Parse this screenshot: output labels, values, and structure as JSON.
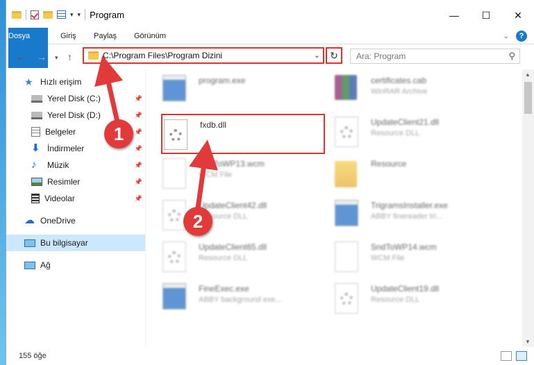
{
  "window": {
    "title": "Program",
    "controls": [
      "minimize",
      "maximize",
      "close"
    ]
  },
  "ribbon": {
    "tabs": [
      "Dosya",
      "Giriş",
      "Paylaş",
      "Görünüm"
    ]
  },
  "address": {
    "path": "C:\\Program Files\\Program Dizini",
    "search_placeholder": "Ara: Program"
  },
  "nav": {
    "quick_access": "Hızlı erişim",
    "pinned": [
      {
        "label": "Yerel Disk (C:)",
        "icon": "drive-icon"
      },
      {
        "label": "Yerel Disk (D:)",
        "icon": "drive-icon"
      },
      {
        "label": "Belgeler",
        "icon": "documents-icon"
      },
      {
        "label": "İndirmeler",
        "icon": "download-icon"
      },
      {
        "label": "Müzik",
        "icon": "music-icon"
      },
      {
        "label": "Resimler",
        "icon": "pictures-icon"
      },
      {
        "label": "Videolar",
        "icon": "videos-icon"
      }
    ],
    "onedrive": "OneDrive",
    "this_pc": "Bu bilgisayar",
    "network": "Ağ"
  },
  "files": [
    {
      "name": "program.exe",
      "type": "",
      "icon": "exe"
    },
    {
      "name": "certificates.cab",
      "type": "WinRAR Archive",
      "icon": "rar"
    },
    {
      "name": "fxdb.dll",
      "type": "",
      "icon": "dll"
    },
    {
      "name": "UpdateClient21.dll",
      "type": "Resource DLL",
      "icon": "dll"
    },
    {
      "name": "SndToWP13.wcm",
      "type": "WCM File",
      "icon": "doc"
    },
    {
      "name": "Resource",
      "type": "",
      "icon": "folder"
    },
    {
      "name": "UpdateClient42.dll",
      "type": "Resource DLL",
      "icon": "dll"
    },
    {
      "name": "TrigramsInstaller.exe",
      "type": "ABBY finereader tri...",
      "icon": "exe"
    },
    {
      "name": "UpdateClient65.dll",
      "type": "Resource DLL",
      "icon": "dll"
    },
    {
      "name": "SndToWP14.wcm",
      "type": "WCM File",
      "icon": "doc"
    },
    {
      "name": "FineExec.exe",
      "type": "ABBY background exe...",
      "icon": "exe"
    },
    {
      "name": "UpdateClient19.dll",
      "type": "Resource DLL",
      "icon": "dll"
    }
  ],
  "status": {
    "count": "155 öğe"
  },
  "annotations": {
    "badge1": "1",
    "badge2": "2",
    "color": "#e03030"
  },
  "colors": {
    "accent": "#1979ca",
    "selection": "#cce8ff"
  }
}
